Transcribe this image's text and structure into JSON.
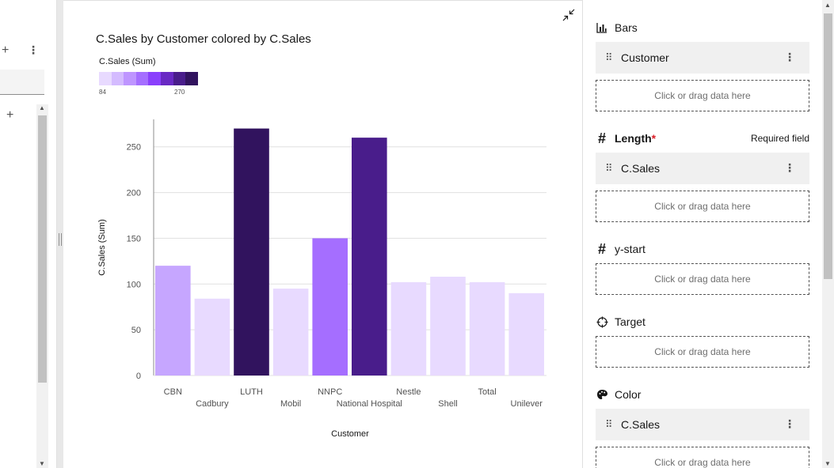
{
  "left_panel": {
    "add_icon": "+",
    "more_icon": "⋮",
    "add_icon_2": "+"
  },
  "chart": {
    "title": "C.Sales by Customer colored by C.Sales",
    "legend": {
      "title": "C.Sales (Sum)",
      "min_label": "84",
      "max_label": "270",
      "scale_colors": [
        "#e8daff",
        "#d4bbff",
        "#be95ff",
        "#a56eff",
        "#8a3ffc",
        "#6929c4",
        "#491d8b",
        "#31135e"
      ]
    }
  },
  "chart_data": {
    "type": "bar",
    "title": "C.Sales by Customer colored by C.Sales",
    "xlabel": "Customer",
    "ylabel": "C.Sales (Sum)",
    "ylim": [
      0,
      280
    ],
    "yticks": [
      0,
      50,
      100,
      150,
      200,
      250
    ],
    "grid": true,
    "categories": [
      "CBN",
      "Cadbury",
      "LUTH",
      "Mobil",
      "NNPC",
      "National Hospital",
      "Nestle",
      "Shell",
      "Total",
      "Unilever"
    ],
    "values": [
      120,
      84,
      270,
      95,
      150,
      260,
      102,
      108,
      102,
      90
    ],
    "colors": [
      "#c6a6ff",
      "#e8daff",
      "#31135e",
      "#e8daff",
      "#a56eff",
      "#491d8b",
      "#e8daff",
      "#e8daff",
      "#e8daff",
      "#e8daff"
    ]
  },
  "right_panel": {
    "bars": {
      "label": "Bars",
      "icon": "bar-chart-icon",
      "field": "Customer",
      "drop_text": "Click or drag data here"
    },
    "length": {
      "label": "Length",
      "icon": "hash-icon",
      "star": "*",
      "required_text": "Required field",
      "field": "C.Sales",
      "drop_text": "Click or drag data here"
    },
    "y_start": {
      "label": "y-start",
      "icon": "hash-icon",
      "drop_text": "Click or drag data here"
    },
    "target": {
      "label": "Target",
      "icon": "crosshair-icon",
      "drop_text": "Click or drag data here"
    },
    "color": {
      "label": "Color",
      "icon": "palette-icon",
      "field": "C.Sales",
      "drop_text": "Click or drag data here"
    }
  },
  "colors": {
    "accent": "#6929c4",
    "drop_border": "#525252",
    "pill_bg": "#f0f0f0",
    "grid": "#e0e0e0"
  }
}
